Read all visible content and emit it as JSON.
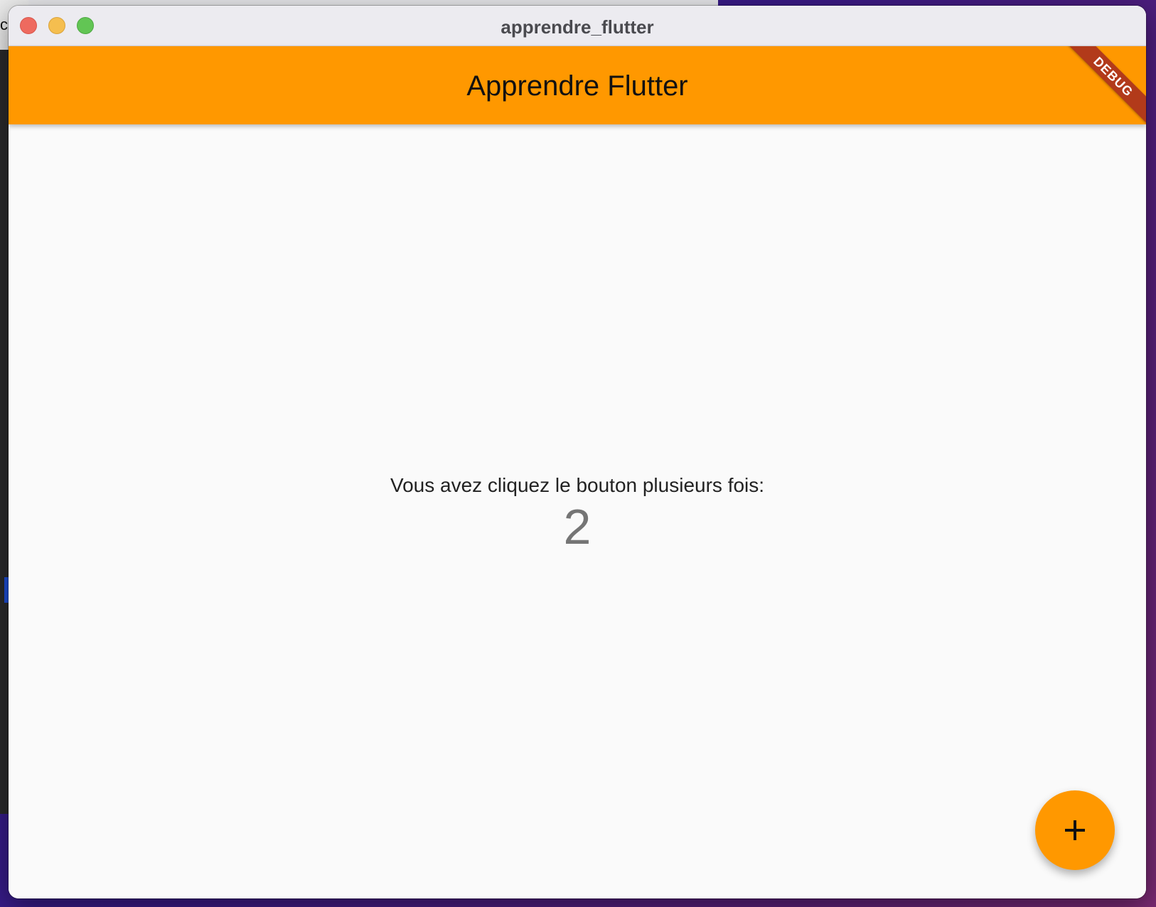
{
  "desktop": {
    "background_window_char": "c"
  },
  "window": {
    "title": "apprendre_flutter",
    "controls": [
      "close",
      "minimize",
      "maximize"
    ]
  },
  "appbar": {
    "title": "Apprendre Flutter",
    "color": "#ff9800"
  },
  "debug_banner": {
    "label": "DEBUG",
    "color": "#b23a1a"
  },
  "main": {
    "counter_label": "Vous avez cliquez le bouton plusieurs fois:",
    "counter_value": "2"
  },
  "fab": {
    "icon": "plus-icon",
    "color": "#ff9800"
  }
}
